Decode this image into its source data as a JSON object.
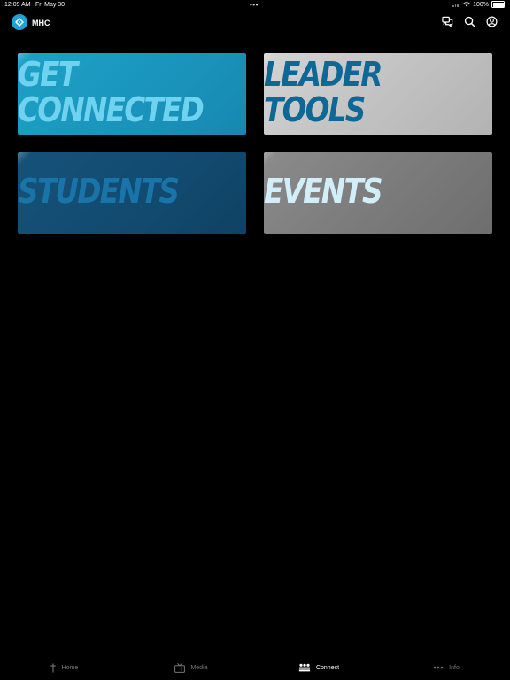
{
  "status_bar": {
    "time": "12:09 AM",
    "date": "Fri May 30",
    "dots": "•••",
    "battery": "100%"
  },
  "header": {
    "title": "MHC",
    "icons": [
      "chat-bubbles-icon",
      "search-icon",
      "profile-icon"
    ]
  },
  "tiles": [
    {
      "line1": "GET",
      "line2": "CONNECTED"
    },
    {
      "line1": "LEADER",
      "line2": "TOOLS"
    },
    {
      "line1": "STUDENTS"
    },
    {
      "line1": "EVENTS"
    }
  ],
  "tabs": [
    {
      "label": "Home",
      "icon": "cross-icon",
      "active": false
    },
    {
      "label": "Media",
      "icon": "tv-icon",
      "active": false
    },
    {
      "label": "Connect",
      "icon": "group-icon",
      "active": true
    },
    {
      "label": "Info",
      "icon": "more-dots-icon",
      "active": false
    }
  ],
  "colors": {
    "brand": "#1ea3d8",
    "background": "#000000"
  }
}
